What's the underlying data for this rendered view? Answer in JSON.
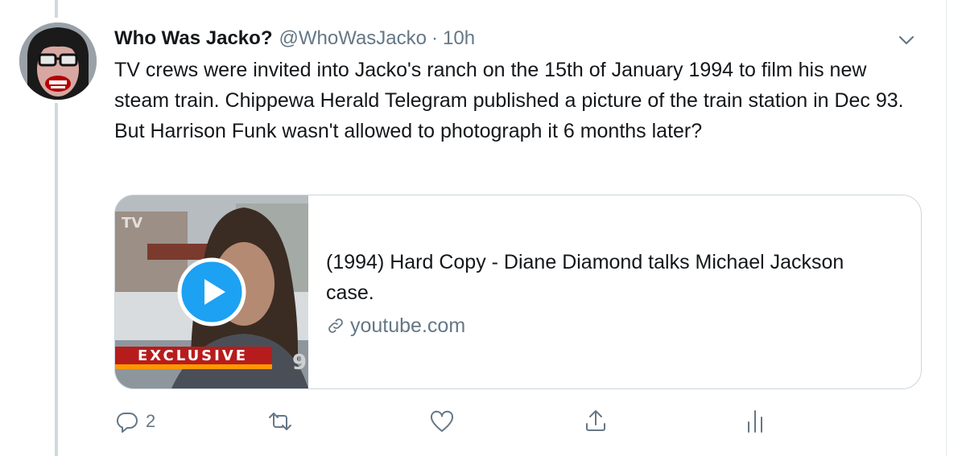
{
  "tweet": {
    "author_name": "Who Was Jacko?",
    "handle": "@WhoWasJacko",
    "separator": "·",
    "timestamp": "10h",
    "text": "TV crews were invited into Jacko's ranch on the 15th of January 1994 to film his new steam train. Chippewa Herald Telegram published a picture of the train station in Dec 93. But Harrison Funk wasn't allowed to photograph it 6 months later?",
    "menu_icon": "chevron-down-icon"
  },
  "card": {
    "title": "(1994) Hard Copy - Diane Diamond talks Michael Jackson case.",
    "domain": "youtube.com",
    "thumbnail_badge": "EXCLUSIVE",
    "play_icon": "play-icon",
    "link_icon": "link-icon"
  },
  "actions": {
    "reply": {
      "icon": "reply-icon",
      "count": "2"
    },
    "retweet": {
      "icon": "retweet-icon",
      "count": ""
    },
    "like": {
      "icon": "heart-icon",
      "count": ""
    },
    "share": {
      "icon": "share-icon"
    },
    "analytics": {
      "icon": "analytics-icon"
    }
  },
  "colors": {
    "play_button": "#1da1f2",
    "secondary_text": "#657786",
    "card_border": "#ccd6dd",
    "badge_red": "#b71c1c",
    "badge_orange": "#ff9800"
  }
}
